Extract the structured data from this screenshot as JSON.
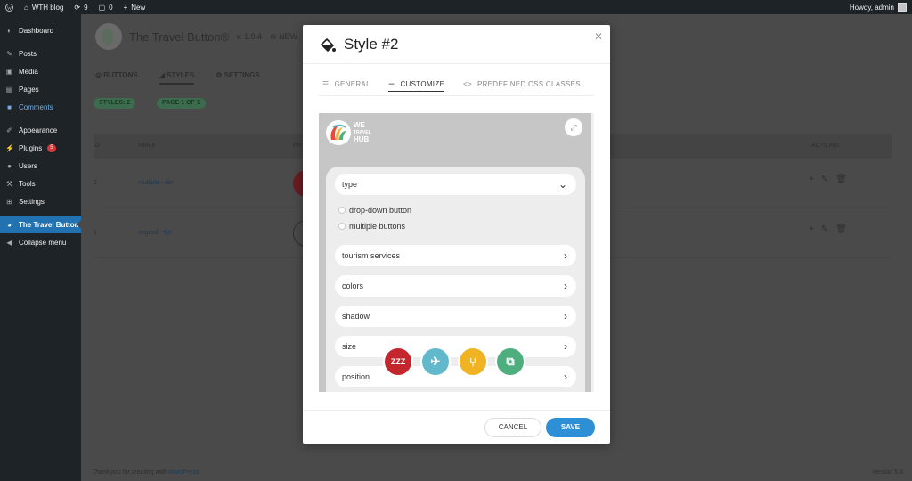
{
  "admin_bar": {
    "site_name": "WTH blog",
    "updates": "9",
    "comments": "0",
    "new_label": "New",
    "howdy": "Howdy, admin"
  },
  "sidebar": {
    "items": [
      {
        "label": "Dashboard",
        "icon": "dashboard-icon"
      },
      {
        "label": "Posts",
        "icon": "pin-icon"
      },
      {
        "label": "Media",
        "icon": "media-icon"
      },
      {
        "label": "Pages",
        "icon": "page-icon"
      },
      {
        "label": "Comments",
        "icon": "comment-icon"
      },
      {
        "label": "Appearance",
        "icon": "brush-icon"
      },
      {
        "label": "Plugins",
        "icon": "plugin-icon",
        "badge": "5"
      },
      {
        "label": "Users",
        "icon": "user-icon"
      },
      {
        "label": "Tools",
        "icon": "wrench-icon"
      },
      {
        "label": "Settings",
        "icon": "settings-icon"
      },
      {
        "label": "The Travel Button",
        "icon": "travel-button-icon"
      },
      {
        "label": "Collapse menu",
        "icon": "collapse-icon"
      }
    ]
  },
  "plugin_page": {
    "title": "The Travel Button®",
    "version": "v. 1.0.4",
    "new_label": "NEW",
    "tabs": [
      "BUTTONS",
      "STYLES",
      "SETTINGS"
    ],
    "pills": [
      "STYLES: 2",
      "PAGE 1 OF 1"
    ],
    "table": {
      "headers": [
        "ID",
        "NAME",
        "PR",
        "ACTIONS"
      ],
      "rows": [
        {
          "id": "2",
          "name": "multiple - fijo"
        },
        {
          "id": "1",
          "name": "original - fijo"
        }
      ]
    },
    "footer_text": "Thank you for creating with",
    "footer_link": "WordPress.",
    "footer_version": "Version 5.8"
  },
  "modal": {
    "title": "Style #2",
    "tabs": [
      "GENERAL",
      "CUSTOMIZE",
      "PREDEFINED CSS CLASSES"
    ],
    "brand": {
      "line1": "WE",
      "line2": "TRAVEL",
      "line3": "HUB"
    },
    "fields": {
      "type": "type",
      "radio_dropdown": "drop-down button",
      "radio_multiple": "multiple buttons",
      "tourism": "tourism services",
      "colors": "colors",
      "shadow": "shadow",
      "size": "size",
      "position": "position"
    },
    "service_buttons": [
      {
        "label": "ZZZ",
        "icon": "sleep-icon",
        "color": "#c4262e"
      },
      {
        "label": "✈",
        "icon": "plane-icon",
        "color": "#62b9cc"
      },
      {
        "label": "⑂",
        "icon": "fork-knife-icon",
        "color": "#f0b323"
      },
      {
        "label": "⧉",
        "icon": "ticket-icon",
        "color": "#4fae7e"
      }
    ],
    "cancel_label": "CANCEL",
    "save_label": "SAVE"
  }
}
